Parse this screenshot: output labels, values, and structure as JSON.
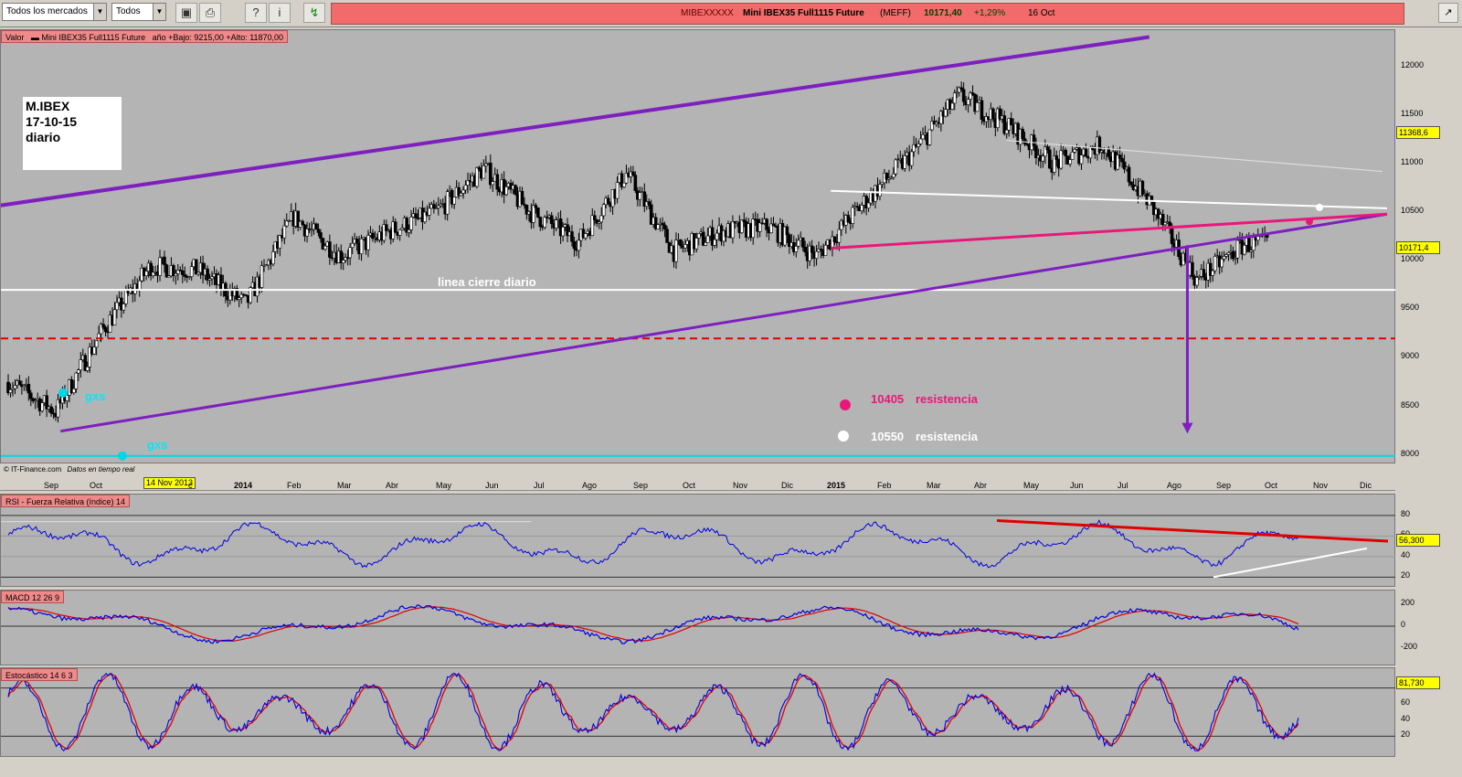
{
  "toolbar": {
    "market_select": "Todos los mercados",
    "type_select": "Todos"
  },
  "quote": {
    "code": "MIBEXXXXX",
    "name": "Mini IBEX35 Full1115 Future",
    "exchange": "(MEFF)",
    "last": "10171,40",
    "change": "+1,29%",
    "date": "16 Oct"
  },
  "colors": {
    "channel": "#7e1fc0",
    "resistance_pink": "#e8187a",
    "support_red": "#e00000",
    "cyan": "#00d8e8",
    "indicator_blue": "#0000e0",
    "signal_red": "#e00000"
  },
  "main": {
    "title": "Valor",
    "legend": "Mini IBEX35 Full1115 Future",
    "range_text": "año +Bajo: 9215,00 +Alto: 11870,00",
    "label_lines": [
      "M.IBEX",
      "17-10-15",
      "diario"
    ],
    "close_line_label": "linea cierre diario",
    "cyan_label_1": "gxs",
    "cyan_label_2": "gxs",
    "legend_pink_value": "10405",
    "legend_pink_text": "resistencia",
    "legend_white_value": "10550",
    "legend_white_text": "resistencia",
    "yticks": [
      "12000",
      "11500",
      "11000",
      "10500",
      "10000",
      "9500",
      "9000",
      "8500",
      "8000"
    ],
    "price_box_1": "11368,6",
    "price_box_2": "10171,4"
  },
  "time_axis": {
    "source": "© IT-Finance.com",
    "realtime": "Datos en tiempo real",
    "date_box": "14 Nov 2013",
    "labels": [
      "Sep",
      "Oct",
      "c",
      "2014",
      "Feb",
      "Mar",
      "Abr",
      "May",
      "Jun",
      "Jul",
      "Ago",
      "Sep",
      "Oct",
      "Nov",
      "Dic",
      "2015",
      "Feb",
      "Mar",
      "Abr",
      "May",
      "Jun",
      "Jul",
      "Ago",
      "Sep",
      "Oct",
      "Nov",
      "Dic"
    ]
  },
  "rsi": {
    "title": "RSI - Fuerza Relativa (índice) 14",
    "yticks": [
      "80",
      "60",
      "40",
      "20"
    ],
    "value_box": "56,300"
  },
  "macd": {
    "title": "MACD 12 26 9",
    "yticks": [
      "200",
      "0",
      "-200"
    ]
  },
  "stoch": {
    "title": "Estocástico 14 6 3",
    "yticks": [
      "81,730",
      "60",
      "40",
      "20"
    ]
  },
  "chart_data": {
    "type": "candlestick",
    "title": "Mini IBEX35 Full1115 Future",
    "ylim": [
      7950,
      12300
    ],
    "yticks": [
      8000,
      8500,
      9000,
      9500,
      10000,
      10500,
      11000,
      11500,
      12000
    ],
    "period_low": 9215,
    "period_high": 11870,
    "close_approx": [
      [
        "2013-08",
        8750
      ],
      [
        "2013-09",
        8450
      ],
      [
        "2013-10",
        9300
      ],
      [
        "2013-11",
        9950
      ],
      [
        "2013-12",
        9900
      ],
      [
        "2014-01",
        9550
      ],
      [
        "2014-02",
        10450
      ],
      [
        "2014-03",
        10050
      ],
      [
        "2014-04",
        10300
      ],
      [
        "2014-05",
        10500
      ],
      [
        "2014-06",
        10950
      ],
      [
        "2014-07",
        10500
      ],
      [
        "2014-08",
        10200
      ],
      [
        "2014-09",
        10900
      ],
      [
        "2014-10",
        10100
      ],
      [
        "2014-11",
        10300
      ],
      [
        "2014-12",
        10350
      ],
      [
        "2015-01",
        10050
      ],
      [
        "2015-02",
        10600
      ],
      [
        "2015-03",
        11100
      ],
      [
        "2015-04",
        11700
      ],
      [
        "2015-05",
        11400
      ],
      [
        "2015-06",
        11000
      ],
      [
        "2015-07",
        11200
      ],
      [
        "2015-08",
        10600
      ],
      [
        "2015-09",
        9800
      ],
      [
        "2015-10",
        10171.4
      ]
    ],
    "horizontal_lines": [
      {
        "label": "linea cierre diario",
        "value": 9700
      },
      {
        "value": 9200
      },
      {
        "value": 7990
      }
    ],
    "resistances": [
      {
        "value": 10405,
        "label": "resistencia"
      },
      {
        "value": 10550,
        "label": "resistencia"
      }
    ],
    "grid": false
  }
}
